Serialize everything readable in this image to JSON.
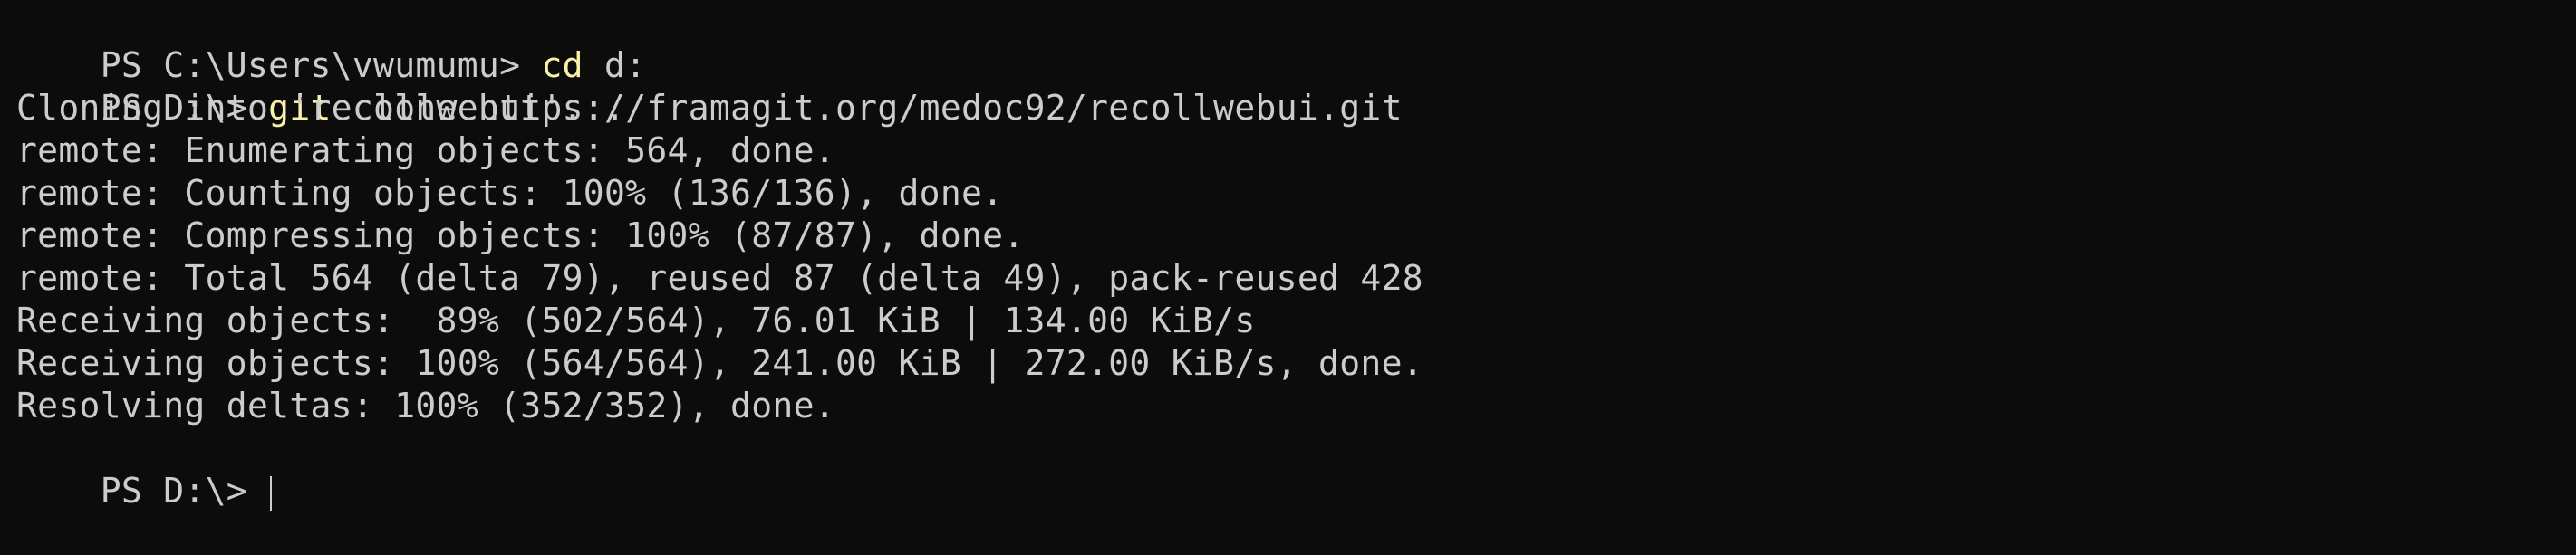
{
  "colors": {
    "background": "#0c0c0c",
    "text": "#cccccc",
    "command_keyword": "#f9f1a5"
  },
  "terminal": {
    "lines": [
      {
        "prompt": "PS C:\\Users\\vwumumu> ",
        "command": "cd",
        "args": " d:"
      },
      {
        "prompt": "PS D:\\> ",
        "command": "git",
        "args": " clone https://framagit.org/medoc92/recollwebui.git"
      },
      {
        "text": "Cloning into 'recollwebui'..."
      },
      {
        "text": "remote: Enumerating objects: 564, done."
      },
      {
        "text": "remote: Counting objects: 100% (136/136), done."
      },
      {
        "text": "remote: Compressing objects: 100% (87/87), done."
      },
      {
        "text": "remote: Total 564 (delta 79), reused 87 (delta 49), pack-reused 428"
      },
      {
        "text": "Receiving objects:  89% (502/564), 76.01 KiB | 134.00 KiB/s"
      },
      {
        "text": "Receiving objects: 100% (564/564), 241.00 KiB | 272.00 KiB/s, done."
      },
      {
        "text": "Resolving deltas: 100% (352/352), done."
      }
    ],
    "current_prompt": "PS D:\\> "
  }
}
